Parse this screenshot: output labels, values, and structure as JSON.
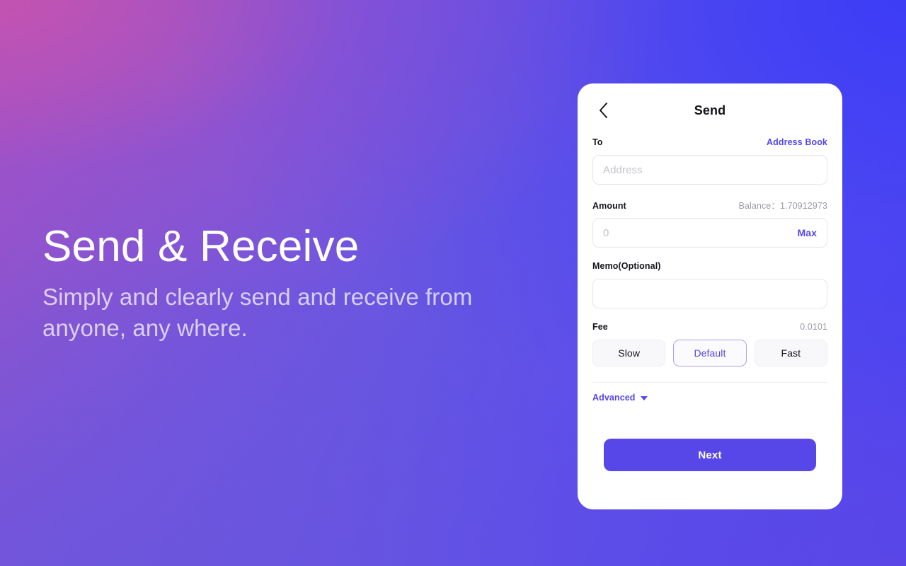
{
  "hero": {
    "title": "Send & Receive",
    "subtitle": "Simply and clearly send and receive from anyone, any where."
  },
  "card": {
    "header": {
      "back_icon": "chevron-left-icon",
      "title": "Send"
    },
    "to_field": {
      "label": "To",
      "link": "Address Book",
      "placeholder": "Address",
      "value": ""
    },
    "amount_field": {
      "label": "Amount",
      "balance": "Balance：1.70912973",
      "placeholder": "0",
      "value": "",
      "action": "Max"
    },
    "memo_field": {
      "label": "Memo(Optional)",
      "placeholder": "",
      "value": ""
    },
    "fee": {
      "label": "Fee",
      "value": "0.0101",
      "options": [
        {
          "label": "Slow",
          "selected": false
        },
        {
          "label": "Default",
          "selected": true
        },
        {
          "label": "Fast",
          "selected": false
        }
      ]
    },
    "advanced": {
      "label": "Advanced",
      "caret_icon": "chevron-down-icon"
    },
    "submit": {
      "label": "Next"
    }
  },
  "colors": {
    "accent": "#5547e8",
    "button": "#5747e8",
    "selected_border": "#a9a1f0",
    "muted_text": "#9b9ba5",
    "placeholder": "#c2c2cb"
  }
}
